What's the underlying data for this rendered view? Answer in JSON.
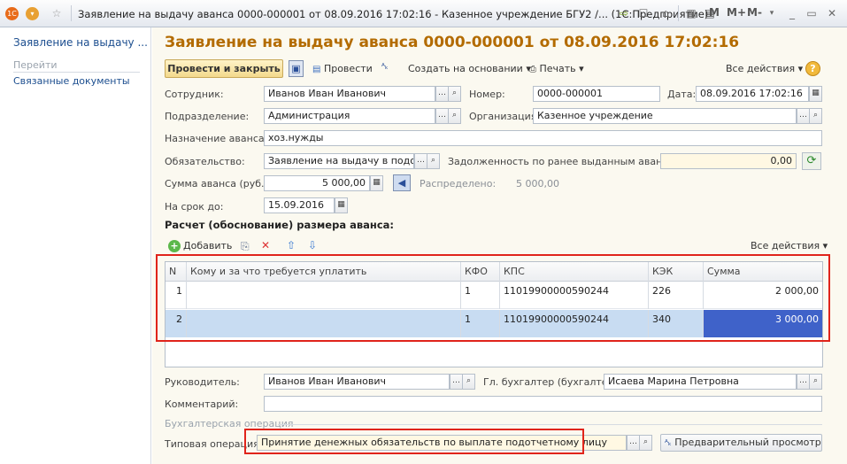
{
  "window": {
    "title": "Заявление на выдачу аванса 0000-000001 от 08.09.2016 17:02:16 - Казенное учреждение БГУ2 /...  (1С:Предприятие)",
    "m": "M",
    "m_plus": "M+",
    "m_minus": "M-"
  },
  "sidebar": {
    "title": "Заявление на выдачу ...",
    "section": "Перейти",
    "links": [
      "Связанные документы"
    ]
  },
  "document": {
    "title": "Заявление на выдачу аванса 0000-000001 от 08.09.2016 17:02:16"
  },
  "toolbar": {
    "post_close": "Провести и закрыть",
    "post": "Провести",
    "create_based": "Создать на основании",
    "print": "Печать",
    "all_actions": "Все действия"
  },
  "form": {
    "employee_label": "Сотрудник:",
    "employee": "Иванов Иван Иванович",
    "number_label": "Номер:",
    "number": "0000-000001",
    "date_label": "Дата:",
    "date": "08.09.2016 17:02:16",
    "department_label": "Подразделение:",
    "department": "Администрация",
    "org_label": "Организация:",
    "org": "Казенное учреждение",
    "purpose_label": "Назначение аванса:",
    "purpose": "хоз.нужды",
    "obligation_label": "Обязательство:",
    "obligation": "Заявление на выдачу в подотчет",
    "debt_label": "Задолженность по ранее выданным авансам:",
    "debt": "0,00",
    "amount_label": "Сумма аванса (руб.):",
    "amount": "5 000,00",
    "distributed_label": "Распределено:",
    "distributed": "5 000,00",
    "term_label": "На срок до:",
    "term": "15.09.2016"
  },
  "calc": {
    "title": "Расчет (обоснование) размера аванса:",
    "add": "Добавить",
    "all_actions": "Все действия",
    "columns": [
      "N",
      "Кому и за что требуется уплатить",
      "КФО",
      "КПС",
      "КЭК",
      "Сумма"
    ],
    "rows": [
      {
        "n": "1",
        "who": "",
        "kfo": "1",
        "kps": "11019900000590244",
        "kek": "226",
        "sum": "2 000,00"
      },
      {
        "n": "2",
        "who": "",
        "kfo": "1",
        "kps": "11019900000590244",
        "kek": "340",
        "sum": "3 000,00"
      }
    ]
  },
  "footer": {
    "head_label": "Руководитель:",
    "head": "Иванов Иван Иванович",
    "accountant_label": "Гл. бухгалтер (бухгалтер):",
    "accountant": "Исаева Марина Петровна",
    "comment_label": "Комментарий:",
    "comment": "",
    "operation_section": "Бухгалтерская операция",
    "typical_op_label": "Типовая операция:",
    "typical_op": "Принятие денежных обязательств по выплате подотчетному лицу",
    "preview": "Предварительный просмотр"
  },
  "colors": {
    "title": "#b36b00",
    "selected_row": "#c8dcf2",
    "selected_cell": "#3f62c9",
    "highlight": "#e0241b"
  }
}
